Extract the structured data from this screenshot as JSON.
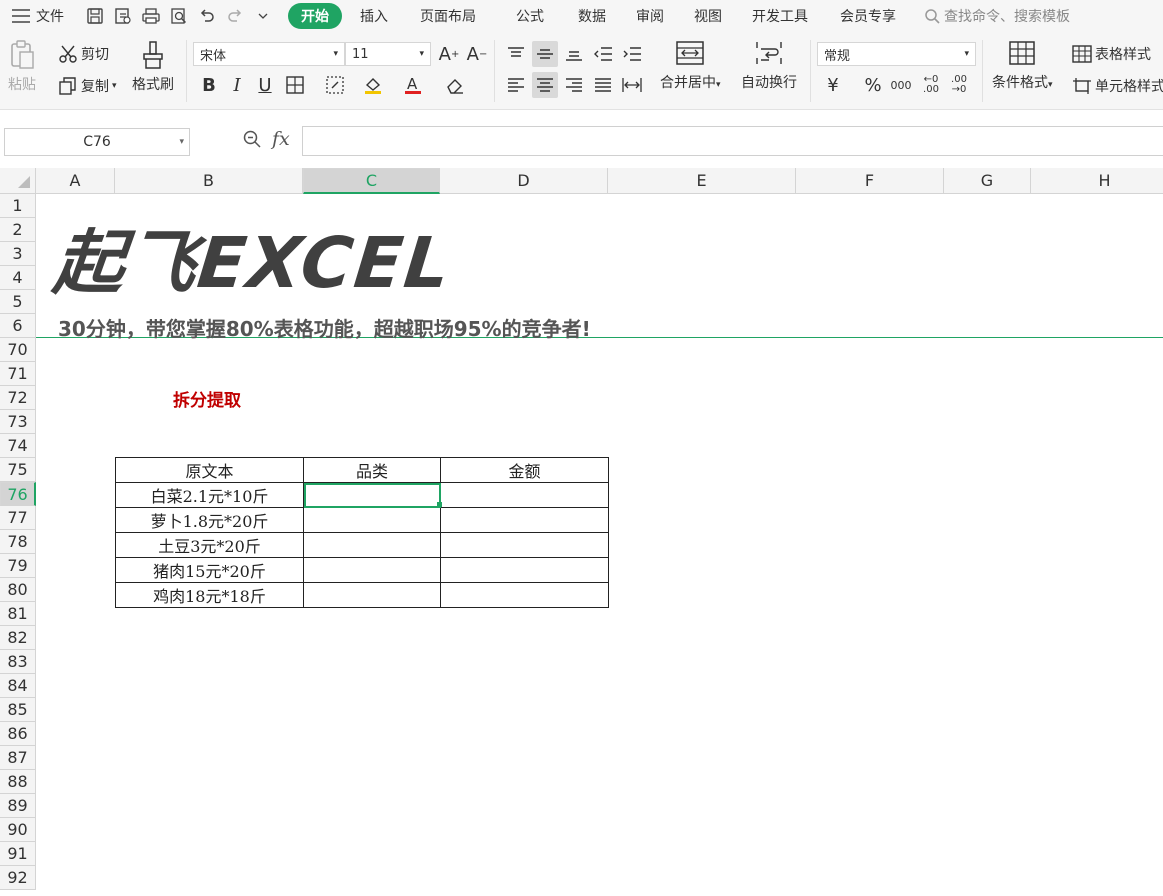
{
  "menu": {
    "file_label": "文件",
    "tabs": [
      "开始",
      "插入",
      "页面布局",
      "公式",
      "数据",
      "审阅",
      "视图",
      "开发工具",
      "会员专享"
    ],
    "search_placeholder": "查找命令、搜索模板"
  },
  "ribbon": {
    "paste": "粘贴",
    "cut": "剪切",
    "copy": "复制",
    "format_painter": "格式刷",
    "font_name": "宋体",
    "font_size": "11",
    "merge_center": "合并居中",
    "wrap_text": "自动换行",
    "number_format": "常规",
    "conditional_format": "条件格式",
    "table_style": "表格样式",
    "cell_style": "单元格样式"
  },
  "formula_bar": {
    "name_box": "C76",
    "fx": "fx",
    "formula": ""
  },
  "columns": [
    {
      "label": "A",
      "selected": false
    },
    {
      "label": "B",
      "selected": false
    },
    {
      "label": "C",
      "selected": true
    },
    {
      "label": "D",
      "selected": false
    },
    {
      "label": "E",
      "selected": false
    },
    {
      "label": "F",
      "selected": false
    },
    {
      "label": "G",
      "selected": false
    },
    {
      "label": "H",
      "selected": false
    }
  ],
  "rows": [
    "1",
    "2",
    "3",
    "4",
    "5",
    "6",
    "70",
    "71",
    "72",
    "73",
    "74",
    "75",
    "76",
    "77",
    "78",
    "79",
    "80",
    "81",
    "82",
    "83",
    "84",
    "85",
    "86",
    "87",
    "88",
    "89",
    "90",
    "91",
    "92"
  ],
  "selected_row": "76",
  "sheet": {
    "logo": "起飞EXCEL",
    "tagline": "30分钟，带您掌握80%表格功能，超越职场95%的竞争者!",
    "section_title": "拆分提取",
    "table": {
      "headers": [
        "原文本",
        "品类",
        "金额"
      ],
      "rows": [
        [
          "白菜2.1元*10斤",
          "",
          ""
        ],
        [
          "萝卜1.8元*20斤",
          "",
          ""
        ],
        [
          "土豆3元*20斤",
          "",
          ""
        ],
        [
          "猪肉15元*20斤",
          "",
          ""
        ],
        [
          "鸡肉18元*18斤",
          "",
          ""
        ]
      ]
    }
  },
  "colors": {
    "accent": "#1fa463",
    "title_red": "#c00000"
  }
}
